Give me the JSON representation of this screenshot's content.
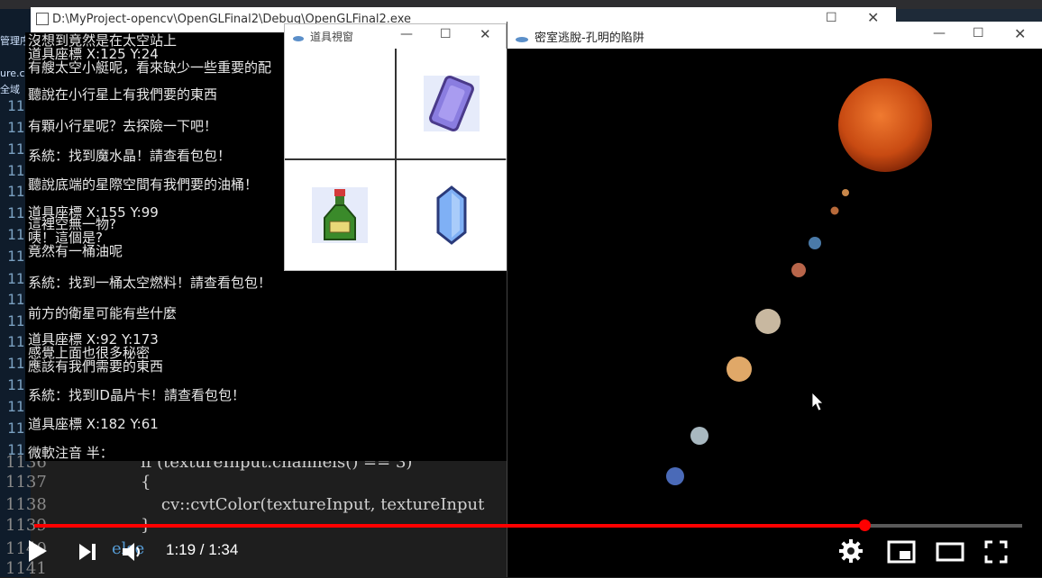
{
  "console": {
    "title": "D:\\MyProject-opencv\\OpenGLFinal2\\Debug\\OpenGLFinal2.exe",
    "lines": [
      "沒想到竟然是在太空站上",
      "道具座標 X:125 Y:24",
      "有艘太空小艇呢，看來缺少一些重要的配",
      "",
      "聽說在小行星上有我們要的東西",
      "",
      "有顆小行星呢？去探險一下吧！",
      "",
      "系統：找到魔水晶！請查看包包！",
      "",
      "聽說底端的星際空間有我們要的油桶！",
      "",
      "道具座標 X:155 Y:99",
      "這裡空無一物?",
      "咦！這個是?",
      "竟然有一桶油呢",
      "",
      "系統：找到一桶太空燃料！請查看包包！",
      "",
      "前方的衛星可能有些什麼",
      "",
      "道具座標 X:92 Y:173",
      "感覺上面也很多秘密",
      "應該有我們需要的東西",
      "",
      "系統：找到ID晶片卡！請查看包包！",
      "",
      "道具座標 X:182 Y:61",
      "",
      "微軟注音 半："
    ]
  },
  "ide": {
    "side_tabs": [
      "管理序",
      "ure.c",
      "全域"
    ],
    "line_numbers": [
      "11",
      "11",
      "11",
      "11",
      "11",
      "11",
      "11",
      "11",
      "11",
      "11",
      "11",
      "11",
      "11",
      "11",
      "11",
      "11",
      "11",
      "11",
      "1136",
      "1137",
      "1138",
      "1139",
      "1140",
      "1141"
    ],
    "code_lines": [
      "if (textureInput.channels() == 3)",
      "{",
      "    cv::cvtColor(textureInput, textureInput",
      "}",
      "else"
    ]
  },
  "items_window": {
    "title": "道具視窗",
    "items": [
      "purple-crystal-card",
      "",
      "green-fuel-bottle",
      "blue-crystal"
    ]
  },
  "game_window": {
    "title": "密室逃脫-孔明的陷阱"
  },
  "player": {
    "current_time": "1:19",
    "duration": "1:34",
    "time_display": "1:19 / 1:34",
    "progress": 0.84,
    "colors": {
      "progress": "#ff0000",
      "controls": "#ffffff"
    }
  }
}
